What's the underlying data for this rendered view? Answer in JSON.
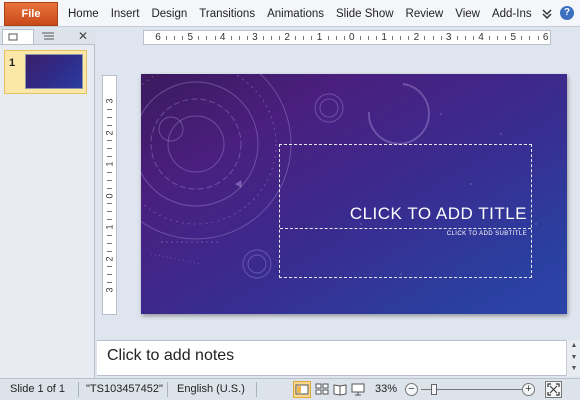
{
  "ribbon": {
    "file_label": "File",
    "tabs": [
      "Home",
      "Insert",
      "Design",
      "Transitions",
      "Animations",
      "Slide Show",
      "Review",
      "View",
      "Add-Ins"
    ],
    "help_glyph": "?",
    "minimize_icon": "chevron-icon"
  },
  "left_panel": {
    "close_glyph": "✕",
    "thumb_number": "1"
  },
  "rulers": {
    "horizontal_labels": [
      "6",
      "5",
      "4",
      "3",
      "2",
      "1",
      "0",
      "1",
      "2",
      "3",
      "4",
      "5",
      "6"
    ],
    "vertical_labels": [
      "3",
      "2",
      "1",
      "0",
      "1",
      "2",
      "3"
    ]
  },
  "slide": {
    "title_placeholder": "CLICK TO ADD TITLE",
    "subtitle_placeholder": "CLICK TO ADD SUBTITLE"
  },
  "notes": {
    "placeholder": "Click to add notes"
  },
  "status": {
    "slide_info": "Slide 1 of 1",
    "theme_name": "\"TS103457452\"",
    "language": "English (U.S.)",
    "zoom_percent": "33%",
    "zoom_value": 33
  },
  "colors": {
    "file_tab": "#d0541f",
    "slide_top": "#4a1f7e",
    "slide_bottom": "#2d44a8",
    "selection": "#fbd88a"
  }
}
